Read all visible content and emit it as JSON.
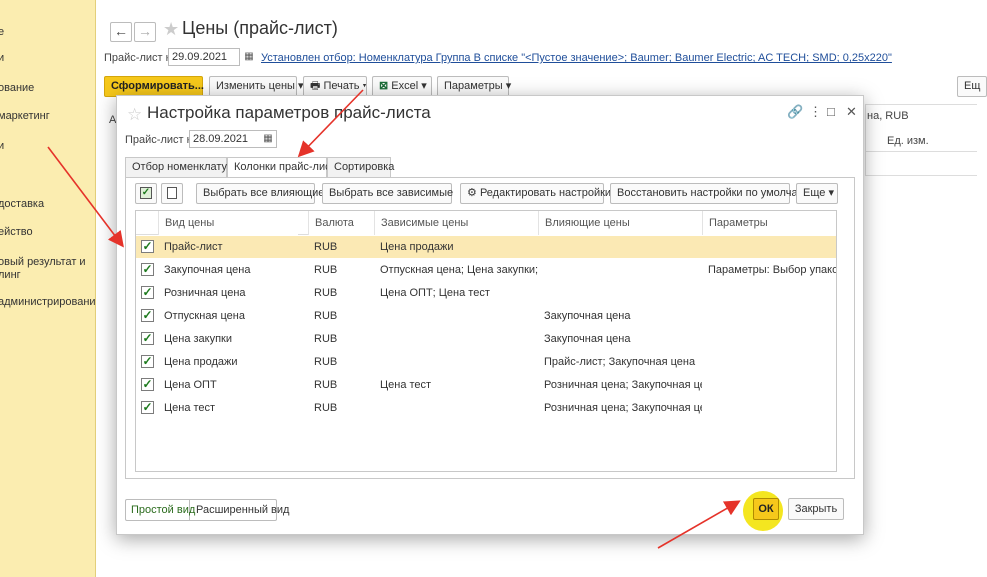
{
  "sidebar": {
    "items": [
      {
        "label": "е"
      },
      {
        "label": "и"
      },
      {
        "label": "ование"
      },
      {
        "label": "маркетинг"
      },
      {
        "label": "и"
      },
      {
        "label": "доставка"
      },
      {
        "label": "ейство"
      },
      {
        "label": "овый результат и\nлинг"
      },
      {
        "label": "администрирование"
      }
    ]
  },
  "main": {
    "back": "←",
    "forward": "→",
    "title": "Цены (прайс-лист)",
    "pricelist_label": "Прайс-лист на:",
    "pricelist_date": "29.09.2021",
    "filter_link": "Установлен отбор: Номенклатура Группа В списке \"<Пустое значение>; Baumer; Baumer Electric; AC TECH; SMD; 0,25x220\"",
    "toolbar": {
      "generate": "Сформировать...",
      "change_prices": "Изменить цены",
      "print": "Печать",
      "excel": "Excel",
      "params": "Параметры",
      "more": "Ещ"
    },
    "bg_col_price": "на, RUB",
    "bg_col_unit": "Ед. изм.",
    "bg_col_a": "А"
  },
  "modal": {
    "title": "Настройка параметров прайс-листа",
    "pricelist_label": "Прайс-лист на:",
    "pricelist_date": "28.09.2021",
    "tabs": [
      {
        "label": "Отбор номенклатуры"
      },
      {
        "label": "Колонки прайс-листа"
      },
      {
        "label": "Сортировка"
      }
    ],
    "toolbar": {
      "select_all_influencing": "Выбрать все влияющие",
      "select_all_dependent": "Выбрать все зависимые",
      "edit_settings": "Редактировать настройки",
      "restore_defaults": "Восстановить настройки по умолчанию",
      "more": "Еще"
    },
    "columns": {
      "price_type": "Вид цены",
      "currency": "Валюта",
      "dependent": "Зависимые цены",
      "influencing": "Влияющие цены",
      "params": "Параметры"
    },
    "rows": [
      {
        "checked": "✓",
        "type": "Прайс-лист",
        "currency": "RUB",
        "dependent": "Цена продажи",
        "influencing": "",
        "params": ""
      },
      {
        "checked": "✓",
        "type": "Закупочная цена",
        "currency": "RUB",
        "dependent": "Отпускная цена; Цена закупки; Це...",
        "influencing": "",
        "params": "Параметры: Выбор упако..."
      },
      {
        "checked": "✓",
        "type": "Розничная цена",
        "currency": "RUB",
        "dependent": "Цена ОПТ; Цена тест",
        "influencing": "",
        "params": ""
      },
      {
        "checked": "✓",
        "type": "Отпускная цена",
        "currency": "RUB",
        "dependent": "",
        "influencing": "Закупочная цена",
        "params": ""
      },
      {
        "checked": "✓",
        "type": "Цена закупки",
        "currency": "RUB",
        "dependent": "",
        "influencing": "Закупочная цена",
        "params": ""
      },
      {
        "checked": "✓",
        "type": "Цена продажи",
        "currency": "RUB",
        "dependent": "",
        "influencing": "Прайс-лист; Закупочная цена",
        "params": ""
      },
      {
        "checked": "✓",
        "type": "Цена ОПТ",
        "currency": "RUB",
        "dependent": "Цена тест",
        "influencing": "Розничная цена; Закупочная цена",
        "params": ""
      },
      {
        "checked": "✓",
        "type": "Цена тест",
        "currency": "RUB",
        "dependent": "",
        "influencing": "Розничная цена; Закупочная цена...",
        "params": ""
      }
    ],
    "view_simple": "Простой вид",
    "view_extended": "Расширенный вид",
    "ok": "ОК",
    "close": "Закрыть"
  },
  "colors": {
    "sidebar": "#fbedb0",
    "accent_yellow": "#f6c81b",
    "selected_row": "#fbe9b4",
    "arrow": "#e5332a",
    "check": "#1e7a1e"
  }
}
